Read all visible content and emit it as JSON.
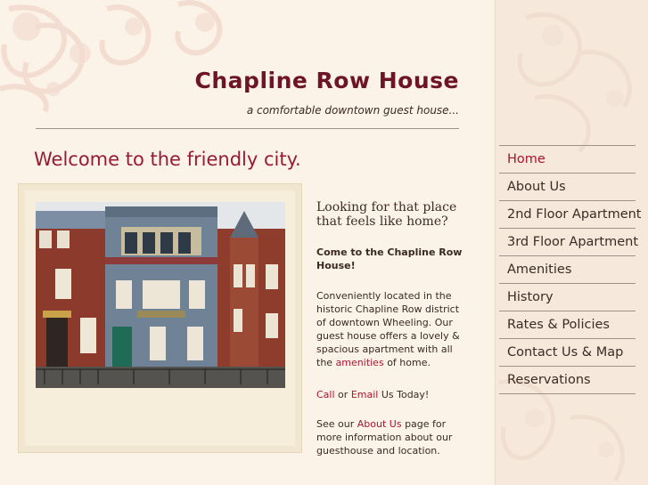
{
  "site": {
    "title": "Chapline Row House",
    "tagline": "a comfortable downtown guest house..."
  },
  "welcome": "Welcome to the friendly city.",
  "photo": {
    "description": "Victorian row houses on Chapline Street"
  },
  "intro": {
    "heading": "Looking for that place that feels like home?",
    "lead": "Come to the Chapline Row House!",
    "p1_text": "Conveniently located in the historic Chapline Row district of downtown Wheeling.  Our guest house offers a lovely & spacious apartment with all the",
    "p1_link": "amenities",
    "p1_end": "of home.",
    "call_link": "Call",
    "or_text": "or",
    "email_link": "Email",
    "today_text": "Us Today!",
    "see_text": "See our",
    "about_link": "About Us",
    "about_end": "page for more information about our guesthouse and location."
  },
  "nav": {
    "items": [
      {
        "label": "Home",
        "active": true
      },
      {
        "label": "About Us"
      },
      {
        "label": "2nd Floor Apartment"
      },
      {
        "label": "3rd Floor Apartment"
      },
      {
        "label": "Amenities"
      },
      {
        "label": "History"
      },
      {
        "label": "Rates & Policies"
      },
      {
        "label": "Contact Us & Map"
      },
      {
        "label": "Reservations"
      }
    ]
  },
  "colors": {
    "title": "#6e1427",
    "accent": "#981b33",
    "link": "#b0152e",
    "background": "#fcf3e8"
  }
}
